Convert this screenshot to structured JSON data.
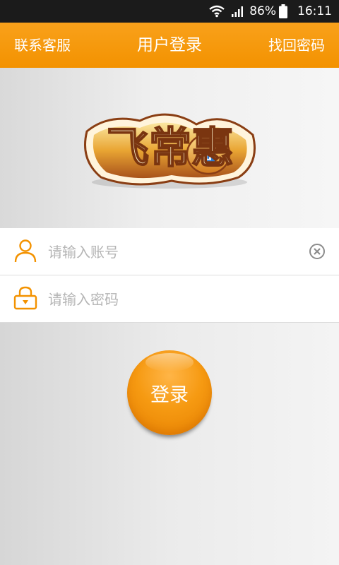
{
  "status_bar": {
    "battery": "86%",
    "time": "16:11",
    "icons": [
      "wifi-icon",
      "signal-icon",
      "battery-icon"
    ]
  },
  "header": {
    "left": "联系客服",
    "title": "用户登录",
    "right": "找回密码"
  },
  "banner": {
    "logo": "飞常惠"
  },
  "form": {
    "account_placeholder": "请输入账号",
    "password_placeholder": "请输入密码"
  },
  "login_button": "登录",
  "colors": {
    "accent": "#f39200",
    "status_bar": "#1b1b1b"
  }
}
